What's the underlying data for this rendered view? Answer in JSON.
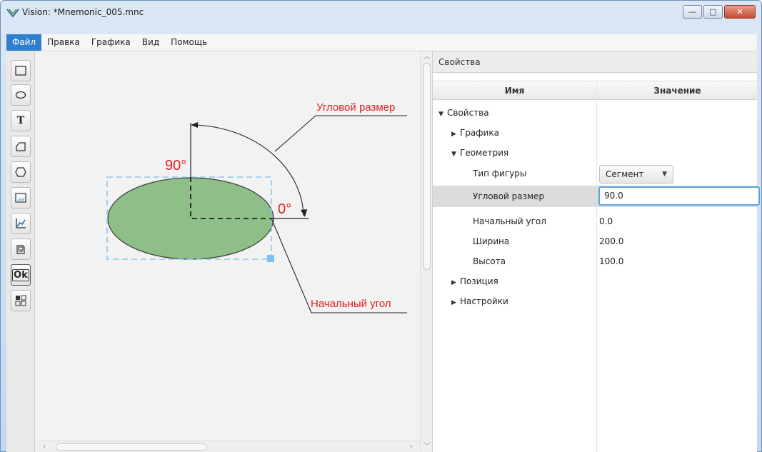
{
  "window": {
    "title": "Vision: *Mnemonic_005.mnc",
    "minimize_glyph": "—",
    "maximize_glyph": "□",
    "close_glyph": "✕"
  },
  "menu": [
    "Файл",
    "Правка",
    "Графика",
    "Вид",
    "Помощь"
  ],
  "toolbox": {
    "text_tool_glyph": "T",
    "ok_tool_label": "Ok",
    "tools": [
      "rectangle-icon",
      "ellipse-icon",
      "text-icon",
      "polyline-icon",
      "polygon-icon",
      "image-icon",
      "chart-icon",
      "device-icon",
      "ok-button-icon",
      "grid-icon"
    ]
  },
  "canvas": {
    "angle_90_label": "90°",
    "angle_0_label": "0°",
    "callout_angular_size": "Угловой размер",
    "callout_start_angle": "Начальный угол",
    "ellipse_fill": "#8fbf88",
    "annotation_color": "#e02020"
  },
  "properties": {
    "header": "Свойства",
    "columns": {
      "name": "Имя",
      "value": "Значение"
    },
    "tree": {
      "root": "Свойства",
      "graphics": "Графика",
      "geometry": "Геометрия",
      "shape_type_label": "Тип фигуры",
      "shape_type_value": "Сегмент",
      "angular_size_label": "Угловой размер",
      "angular_size_value": "90.0",
      "start_angle_label": "Начальный угол",
      "start_angle_value": "0.0",
      "width_label": "Ширина",
      "width_value": "200.0",
      "height_label": "Высота",
      "height_value": "100.0",
      "position": "Позиция",
      "settings": "Настройки"
    }
  },
  "colors": {
    "accent": "#2f7fcf",
    "selection_dash": "#7ec0f0"
  }
}
